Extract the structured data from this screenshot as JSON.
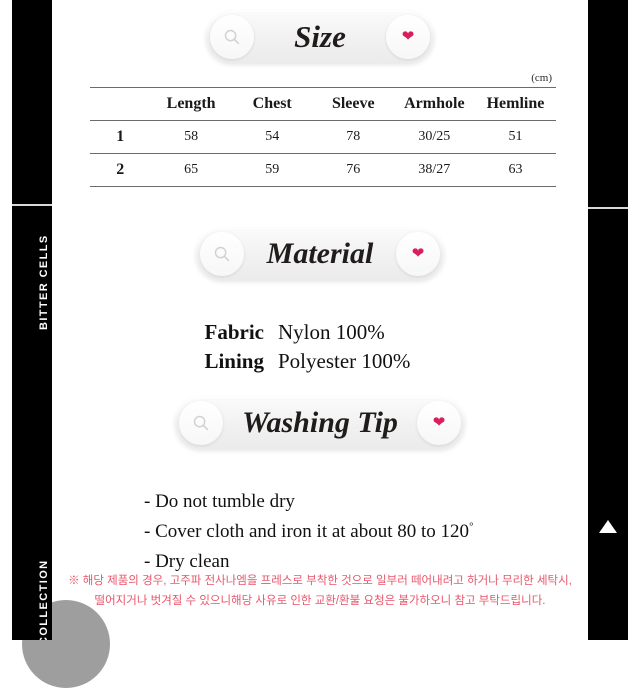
{
  "sidebar": {
    "brand_label": "BITTER CELLS",
    "collection_label": "COLLECTION"
  },
  "right_rail": {
    "scroll_top_icon": "triangle-up-icon"
  },
  "sections": {
    "size": {
      "heading": "Size",
      "search_icon": "search-icon",
      "heart_icon": "heart-icon",
      "unit": "(cm)",
      "table": {
        "columns": [
          "",
          "Length",
          "Chest",
          "Sleeve",
          "Armhole",
          "Hemline"
        ],
        "rows": [
          {
            "index": "1",
            "length": "58",
            "chest": "54",
            "sleeve": "78",
            "armhole": "30/25",
            "hemline": "51"
          },
          {
            "index": "2",
            "length": "65",
            "chest": "59",
            "sleeve": "76",
            "armhole": "38/27",
            "hemline": "63"
          }
        ]
      }
    },
    "material": {
      "heading": "Material",
      "search_icon": "search-icon",
      "heart_icon": "heart-icon",
      "rows": [
        {
          "key": "Fabric",
          "value": "Nylon 100%"
        },
        {
          "key": "Lining",
          "value": "Polyester 100%"
        }
      ]
    },
    "washing": {
      "heading": "Washing Tip",
      "search_icon": "search-icon",
      "heart_icon": "heart-icon",
      "items": [
        "- Do not tumble dry",
        "- Cover cloth and iron it at about 80 to 120",
        "- Dry clean"
      ],
      "degree_symbol": "°"
    }
  },
  "notice": {
    "line1": "※ 해당 제품의 경우, 고주파 전사나엠을 프레스로 부착한 것으로 일부러 떼어내려고 하거나 무리한 세탁시,",
    "line2": "떨어지거나 벗겨질 수 있으니해당 사유로 인한 교환/환불 요청은 불가하오니 참고 부탁드립니다."
  },
  "colors": {
    "heart": "#d81e5b",
    "notice_text": "#e8556a",
    "rail": "#000000"
  }
}
